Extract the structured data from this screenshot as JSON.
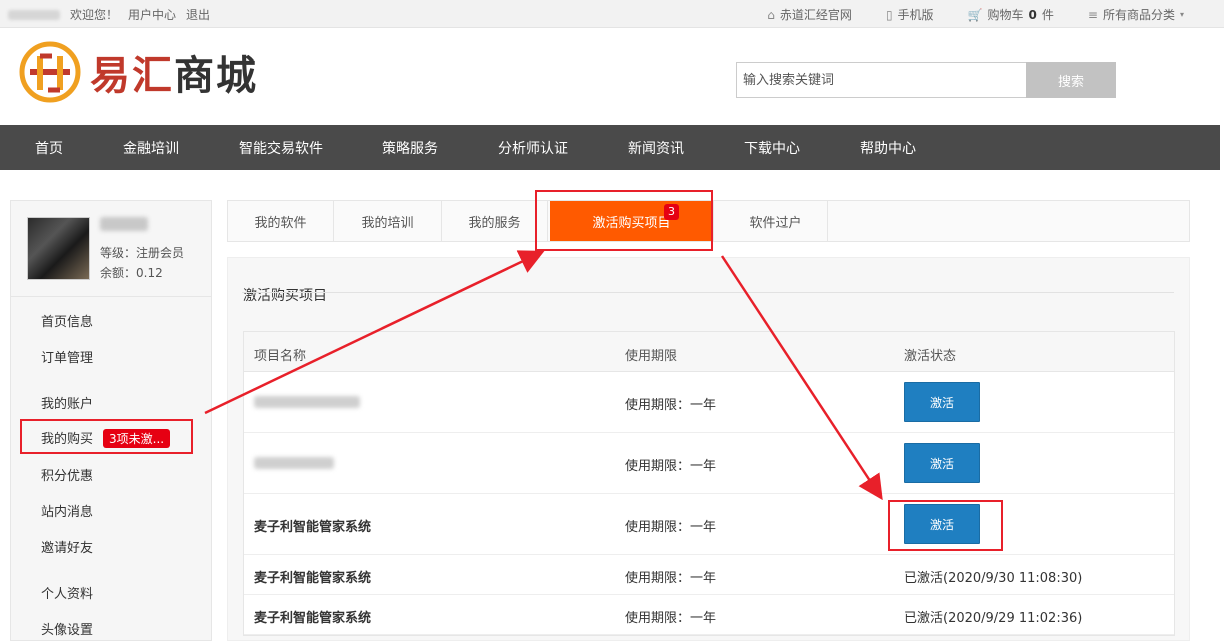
{
  "topbar": {
    "welcome": "欢迎您！",
    "user_center": "用户中心",
    "logout": "退出",
    "official_site": "赤道汇经官网",
    "mobile": "手机版",
    "cart_label": "购物车",
    "cart_count": "0",
    "cart_unit": "件",
    "categories": "所有商品分类"
  },
  "header": {
    "logo_text_red": "易汇",
    "logo_text_dark": "商城",
    "search_placeholder": "输入搜索关键词",
    "search_button": "搜索"
  },
  "nav": {
    "items": [
      "首页",
      "金融培训",
      "智能交易软件",
      "策略服务",
      "分析师认证",
      "新闻资讯",
      "下载中心",
      "帮助中心"
    ]
  },
  "sidebar": {
    "level": "等级：注册会员",
    "balance": "余额：0.12",
    "menu": [
      {
        "label": "首页信息"
      },
      {
        "label": "订单管理"
      },
      {
        "label": "我的账户"
      },
      {
        "label": "我的购买",
        "badge": "3项未激..."
      },
      {
        "label": "积分优惠"
      },
      {
        "label": "站内消息"
      },
      {
        "label": "邀请好友"
      },
      {
        "label": "个人资料"
      },
      {
        "label": "头像设置"
      }
    ]
  },
  "tabs": {
    "items": [
      "我的软件",
      "我的培训",
      "我的服务",
      "激活购买项目",
      "软件过户"
    ],
    "active_badge": "3"
  },
  "panel": {
    "title": "激活购买项目",
    "headers": [
      "项目名称",
      "使用期限",
      "激活状态"
    ],
    "rows": [
      {
        "name": "",
        "term": "使用期限：一年",
        "status": "激活"
      },
      {
        "name": "",
        "term": "使用期限：一年",
        "status": "激活"
      },
      {
        "name": "麦子利智能管家系统",
        "term": "使用期限：一年",
        "status": "激活"
      },
      {
        "name": "麦子利智能管家系统",
        "term": "使用期限：一年",
        "status": "已激活(2020/9/30 11:08:30)"
      },
      {
        "name": "麦子利智能管家系统",
        "term": "使用期限：一年",
        "status": "已激活(2020/9/29 11:02:36)"
      }
    ]
  },
  "colors": {
    "accent_orange": "#ff5a00",
    "button_blue": "#1f7fc1",
    "annotation_red": "#e8202a",
    "nav_bg": "#4a4a4a"
  }
}
